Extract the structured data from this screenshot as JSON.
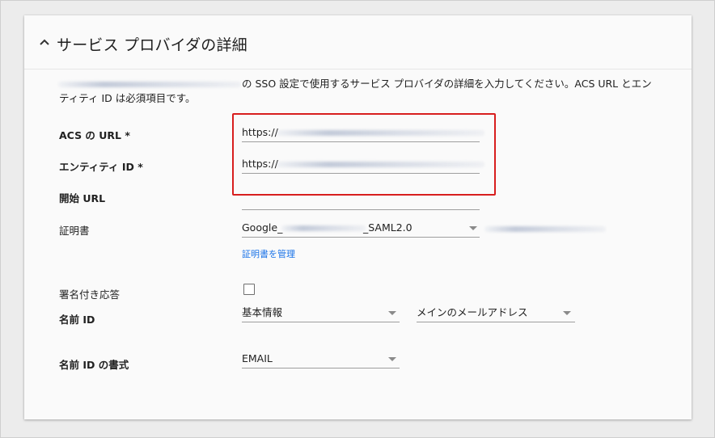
{
  "section": {
    "title": "サービス プロバイダの詳細",
    "description_line1": "の SSO 設定で使用するサービス プロバイダの詳細を入力してください。ACS URL とエン",
    "description_line2": "ティティ ID は必須項目です。"
  },
  "fields": {
    "acs_url": {
      "label": "ACS の URL *",
      "value": "https://"
    },
    "entity_id": {
      "label": "エンティティ ID *",
      "value": "https://"
    },
    "start_url": {
      "label": "開始 URL",
      "value": ""
    },
    "certificate": {
      "label": "証明書",
      "value_prefix": "Google_",
      "value_suffix": "_SAML2.0",
      "manage_link": "証明書を管理"
    },
    "signed_response": {
      "label": "署名付き応答",
      "checked": false
    },
    "name_id": {
      "label": "名前 ID",
      "basic_info": "基本情報",
      "primary_email": "メインのメールアドレス"
    },
    "name_id_format": {
      "label": "名前 ID の書式",
      "value": "EMAIL"
    }
  },
  "colors": {
    "highlight": "#d81e1e",
    "link": "#1a73e8"
  }
}
